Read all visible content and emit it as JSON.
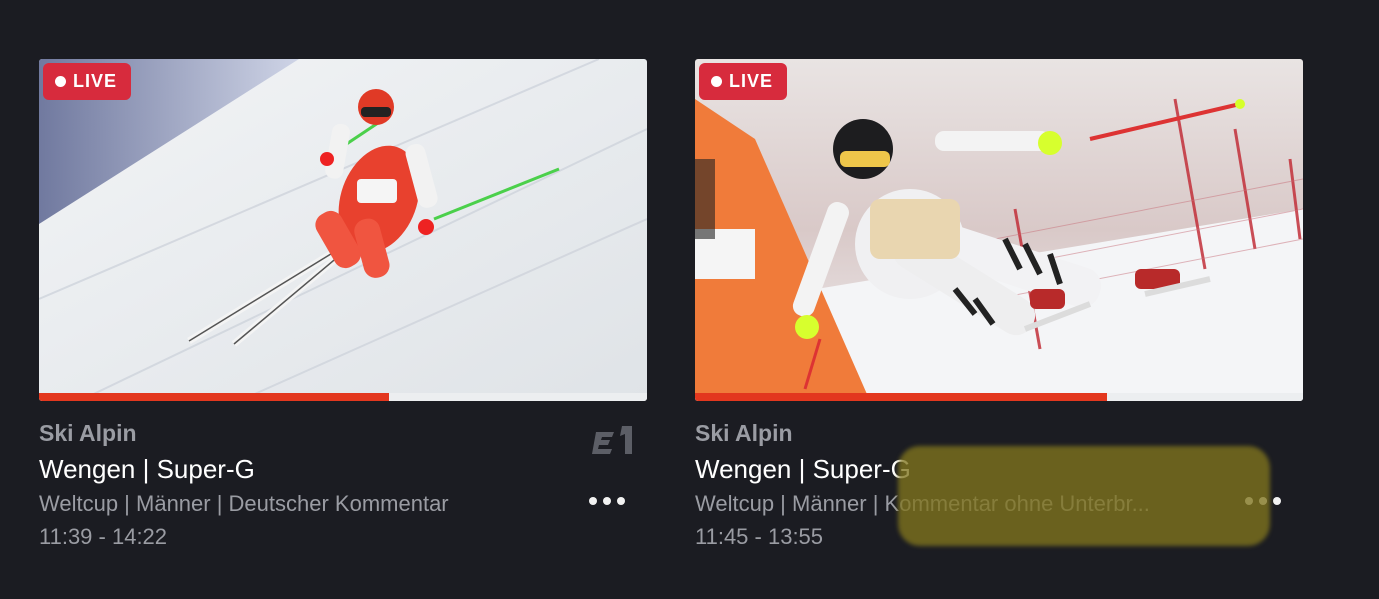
{
  "cards": [
    {
      "live_label": "LIVE",
      "sport": "Ski Alpin",
      "title": "Wengen | Super-G",
      "subtitle": "Weltcup | Männer | Deutscher Kommentar",
      "time": "11:39 - 14:22",
      "progress": 0.575,
      "channel_logo": "eurosport-1-logo",
      "more_icon": "more-dots-icon"
    },
    {
      "live_label": "LIVE",
      "sport": "Ski Alpin",
      "title": "Wengen | Super-G",
      "subtitle": "Weltcup | Männer | Kommentar ohne Unterbr...",
      "time": "11:45 - 13:55",
      "progress": 0.678,
      "more_icon": "more-dots-icon"
    }
  ],
  "colors": {
    "background": "#1b1c22",
    "live_badge": "#d72b3d",
    "progress": "#e3371e",
    "highlight": "#80741e"
  }
}
